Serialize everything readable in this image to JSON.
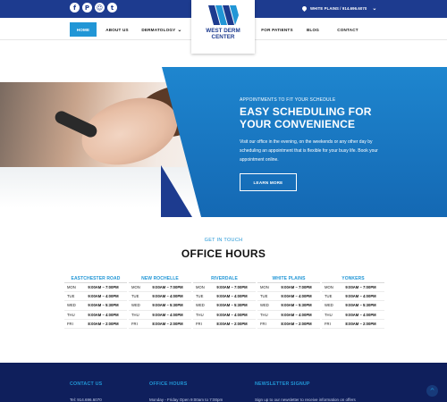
{
  "topbar": {
    "social_icons": [
      "facebook-icon",
      "pinterest-icon",
      "snapchat-icon",
      "twitter-icon"
    ],
    "social_glyphs": [
      "f",
      "P",
      "☺",
      "t"
    ],
    "location": "WHITE PLAINS / 914.696.6070"
  },
  "logo": {
    "line1": "WEST DERM",
    "line2": "CENTER"
  },
  "nav": {
    "home": "HOME",
    "about": "ABOUT US",
    "dermatology": "DERMATOLOGY",
    "patients": "FOR PATIENTS",
    "blog": "BLOG",
    "contact": "CONTACT"
  },
  "hero": {
    "kicker": "APPOINTMENTS TO FIT YOUR SCHEDULE",
    "title_line1": "EASY SCHEDULING FOR",
    "title_line2": "YOUR CONVENIENCE",
    "body": "Visit our office in the evening, on the weekends or any other day by scheduling an appointment that is flexible for your busy life. Book your appointment online.",
    "button": "LEARN MORE"
  },
  "hours": {
    "kicker": "GET IN TOUCH",
    "title": "OFFICE HOURS",
    "locations": [
      {
        "name": "EASTCHESTER ROAD",
        "rows": [
          [
            "MON",
            "9:00AM – 7:00PM"
          ],
          [
            "TUE",
            "9:00AM – 4:00PM"
          ],
          [
            "WED",
            "9:00AM – 5:30PM"
          ],
          [
            "THU",
            "9:00AM – 4:00PM"
          ],
          [
            "FRI",
            "8:00AM – 2:00PM"
          ]
        ]
      },
      {
        "name": "NEW ROCHELLE",
        "rows": [
          [
            "MON",
            "9:00AM – 7:00PM"
          ],
          [
            "TUE",
            "9:00AM – 4:00PM"
          ],
          [
            "WED",
            "9:00AM – 5:30PM"
          ],
          [
            "THU",
            "9:00AM – 4:00PM"
          ],
          [
            "FRI",
            "8:00AM – 2:00PM"
          ]
        ]
      },
      {
        "name": "RIVERDALE",
        "rows": [
          [
            "MON",
            "9:00AM – 7:00PM"
          ],
          [
            "TUE",
            "9:00AM – 4:00PM"
          ],
          [
            "WED",
            "9:00AM – 5:30PM"
          ],
          [
            "THU",
            "9:00AM – 4:00PM"
          ],
          [
            "FRI",
            "8:00AM – 2:00PM"
          ]
        ]
      },
      {
        "name": "WHITE PLAINS",
        "rows": [
          [
            "MON",
            "9:00AM – 7:00PM"
          ],
          [
            "TUE",
            "9:00AM – 4:00PM"
          ],
          [
            "WED",
            "9:00AM – 5:30PM"
          ],
          [
            "THU",
            "9:00AM – 4:00PM"
          ],
          [
            "FRI",
            "8:00AM – 2:00PM"
          ]
        ]
      },
      {
        "name": "YONKERS",
        "rows": [
          [
            "MON",
            "9:00AM – 7:00PM"
          ],
          [
            "TUE",
            "9:00AM – 4:00PM"
          ],
          [
            "WED",
            "9:00AM – 5:30PM"
          ],
          [
            "THU",
            "9:00AM – 4:00PM"
          ],
          [
            "FRI",
            "8:00AM – 2:00PM"
          ]
        ]
      }
    ]
  },
  "footer": {
    "contact_heading": "CONTACT US",
    "contact_text": "Tel: 914.696.6070",
    "hours_heading": "OFFICE HOURS",
    "hours_text": "Monday - Friday Open 9:00am to 7:00pm",
    "newsletter_heading": "NEWSLETTER SIGNUP",
    "newsletter_text": "Sign up to our newsletter to receive information on offers",
    "to_top": "^"
  },
  "colors": {
    "navy": "#1d3b8f",
    "blue": "#2196d6",
    "footer": "#0f1f5c"
  }
}
